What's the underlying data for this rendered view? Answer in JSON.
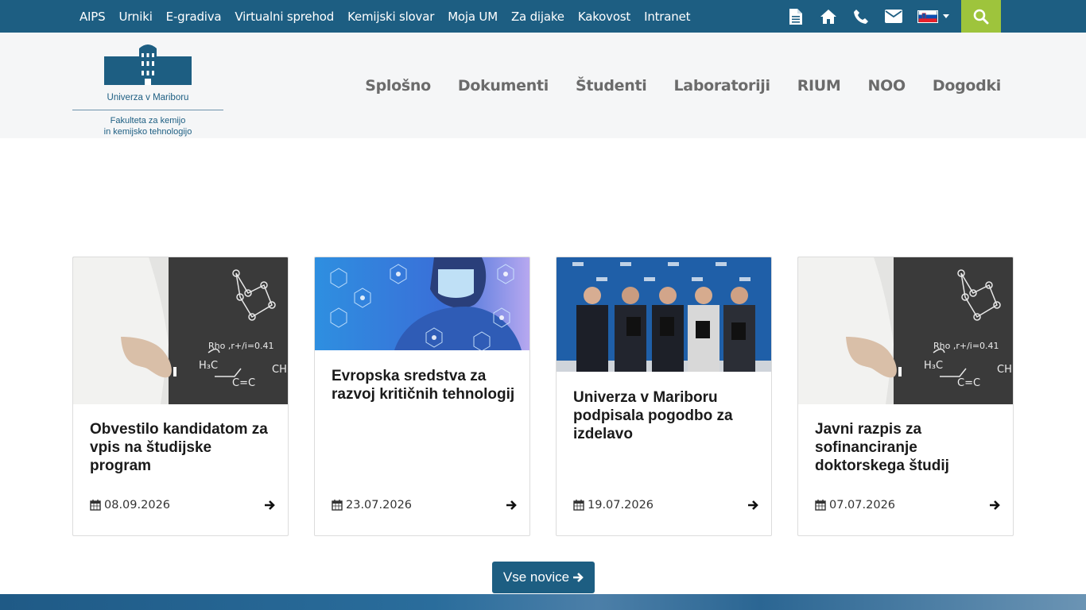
{
  "topbar": {
    "links": [
      "AIPS",
      "Urniki",
      "E-gradiva",
      "Virtualni sprehod",
      "Kemijski slovar",
      "Moja UM",
      "Za dijake",
      "Kakovost",
      "Intranet"
    ],
    "icons": [
      "document-icon",
      "home-icon",
      "phone-icon",
      "mail-icon",
      "slovenia-flag-icon",
      "search-icon"
    ],
    "accent_color": "#1d5e82",
    "search_color": "#9ec43c"
  },
  "logo": {
    "university": "Univerza v Mariboru",
    "faculty_line1": "Fakulteta za kemijo",
    "faculty_line2": "in kemijsko tehnologijo"
  },
  "nav": [
    "Splošno",
    "Dokumenti",
    "Študenti",
    "Laboratoriji",
    "RIUM",
    "NOO",
    "Dogodki"
  ],
  "news": [
    {
      "title": "Obvestilo kandidatom za vpis na študijske program",
      "date": "08.09.2026",
      "image": "scientist-chalkboard"
    },
    {
      "title": "Evropska sredstva za razvoj kritičnih tehnologij",
      "date": "23.07.2026",
      "image": "lab-researcher-hexagons"
    },
    {
      "title": "Univerza v Mariboru podpisala pogodbo za izdelavo",
      "date": "19.07.2026",
      "image": "group-photo-signing"
    },
    {
      "title": "Javni razpis za sofinanciranje doktorskega študij",
      "date": "07.07.2026",
      "image": "scientist-chalkboard"
    }
  ],
  "all_news_button": "Vse novice"
}
